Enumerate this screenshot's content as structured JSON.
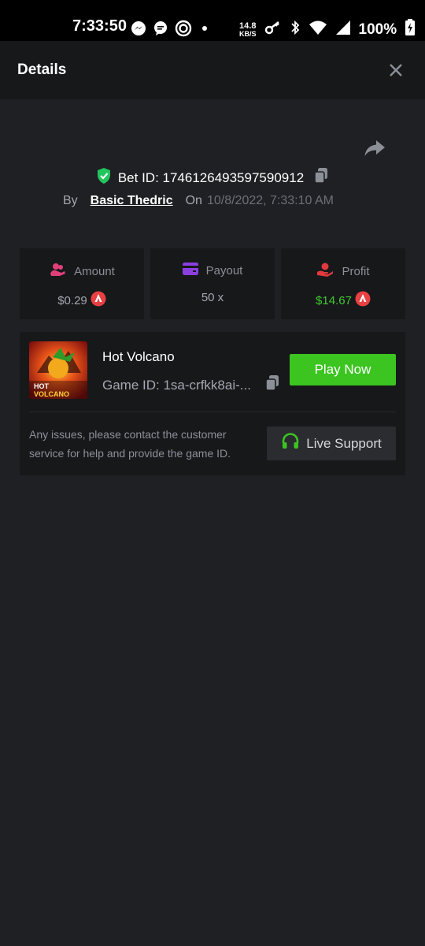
{
  "status_bar": {
    "time": "7:33:50",
    "net_speed_value": "14.8",
    "net_speed_unit": "KB/S",
    "battery": "100%"
  },
  "header": {
    "title": "Details"
  },
  "bet": {
    "id_label": "Bet ID: 1746126493597590912",
    "by_label": "By",
    "username": "Basic Thedric",
    "on_label": "On",
    "date": "10/8/2022, 7:33:10 AM"
  },
  "stats": {
    "amount": {
      "label": "Amount",
      "value": "$0.29"
    },
    "payout": {
      "label": "Payout",
      "value": "50 x"
    },
    "profit": {
      "label": "Profit",
      "value": "$14.67"
    }
  },
  "game": {
    "name": "Hot Volcano",
    "id_label": "Game ID: 1sa-crfkk8ai-...",
    "play_label": "Play Now",
    "thumb_text_line1": "HOT",
    "thumb_text_line2": "VOLCANO"
  },
  "support": {
    "help_text": "Any issues, please contact the customer service for help and provide the game ID.",
    "button_label": "Live Support"
  },
  "colors": {
    "background": "#1f2023",
    "panel": "#17181a",
    "accent_green": "#3cc421",
    "profit_green": "#41c830",
    "shield_green": "#22c55e",
    "coin_red": "#e84142",
    "amount_pink": "#e0407a",
    "payout_purple": "#8b3fe0",
    "profit_red": "#e0393e"
  }
}
